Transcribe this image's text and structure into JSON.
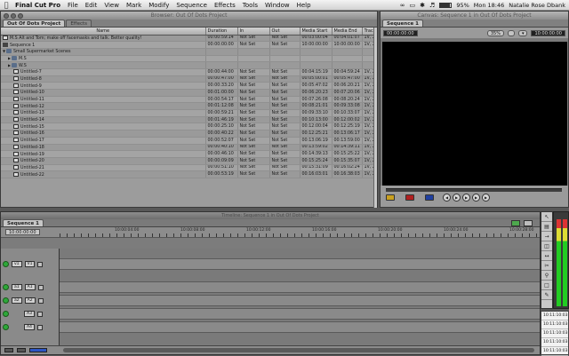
{
  "menubar": {
    "app": "Final Cut Pro",
    "items": [
      "File",
      "Edit",
      "View",
      "Mark",
      "Modify",
      "Sequence",
      "Effects",
      "Tools",
      "Window",
      "Help"
    ],
    "battery": "95%",
    "clock": "Mon 18:46",
    "user": "Natalie Rose Dbank"
  },
  "browser": {
    "title": "Browser: Out Of Dots Project",
    "tabs": [
      "Out Of Dots Project",
      "Effects"
    ],
    "columns": [
      "Name",
      "Duration",
      "In",
      "Out",
      "Media Start",
      "Media End",
      "Tracks"
    ],
    "rows": [
      {
        "kind": "clip",
        "indent": 0,
        "name": "M.S Alt and Tom; make off facemasks and talk. Better quality!",
        "duration": "00:00:59:14",
        "in": "Not Set",
        "out": "Not Set",
        "ms": "00:03:00:04",
        "me": "00:04:01:07",
        "tr": "1V, 2"
      },
      {
        "kind": "seq",
        "indent": 0,
        "name": "Sequence 1",
        "duration": "00:00:00:00",
        "in": "Not Set",
        "out": "Not Set",
        "ms": "10:00:00:00",
        "me": "10:00:00:00",
        "tr": "1V, 2"
      },
      {
        "kind": "bin",
        "indent": 0,
        "name": "Small Supermarket Scenes",
        "duration": "",
        "in": "",
        "out": "",
        "ms": "",
        "me": "",
        "tr": ""
      },
      {
        "kind": "bin",
        "indent": 1,
        "name": "M.S",
        "duration": "",
        "in": "",
        "out": "",
        "ms": "",
        "me": "",
        "tr": ""
      },
      {
        "kind": "bin",
        "indent": 1,
        "name": "W.S",
        "duration": "",
        "in": "",
        "out": "",
        "ms": "",
        "me": "",
        "tr": ""
      },
      {
        "kind": "clip",
        "indent": 2,
        "name": "Untitled-7",
        "duration": "00:00:44:00",
        "in": "Not Set",
        "out": "Not Set",
        "ms": "00:04:15:19",
        "me": "00:04:59:24",
        "tr": "1V, 2"
      },
      {
        "kind": "clip",
        "indent": 2,
        "name": "Untitled-8",
        "duration": "00:00:47:00",
        "in": "Not Set",
        "out": "Not Set",
        "ms": "00:05:00:01",
        "me": "00:05:47:00",
        "tr": "1V, 2"
      },
      {
        "kind": "clip",
        "indent": 2,
        "name": "Untitled-9",
        "duration": "00:00:33:20",
        "in": "Not Set",
        "out": "Not Set",
        "ms": "00:05:47:02",
        "me": "00:06:20:21",
        "tr": "1V, 2"
      },
      {
        "kind": "clip",
        "indent": 2,
        "name": "Untitled-10",
        "duration": "00:01:00:00",
        "in": "Not Set",
        "out": "Not Set",
        "ms": "00:06:20:23",
        "me": "00:07:20:06",
        "tr": "1V, 2"
      },
      {
        "kind": "clip",
        "indent": 2,
        "name": "Untitled-11",
        "duration": "00:00:54:17",
        "in": "Not Set",
        "out": "Not Set",
        "ms": "00:07:26:08",
        "me": "00:08:20:24",
        "tr": "1V, 2"
      },
      {
        "kind": "clip",
        "indent": 2,
        "name": "Untitled-12",
        "duration": "00:01:12:08",
        "in": "Not Set",
        "out": "Not Set",
        "ms": "00:08:21:01",
        "me": "00:09:33:08",
        "tr": "1V, 2"
      },
      {
        "kind": "clip",
        "indent": 2,
        "name": "Untitled-13",
        "duration": "00:00:59:21",
        "in": "Not Set",
        "out": "Not Set",
        "ms": "00:09:33:10",
        "me": "00:10:33:07",
        "tr": "1V, 2"
      },
      {
        "kind": "clip",
        "indent": 2,
        "name": "Untitled-14",
        "duration": "00:01:46:19",
        "in": "Not Set",
        "out": "Not Set",
        "ms": "00:10:13:00",
        "me": "00:12:00:02",
        "tr": "1V, 2"
      },
      {
        "kind": "clip",
        "indent": 2,
        "name": "Untitled-15",
        "duration": "00:00:25:10",
        "in": "Not Set",
        "out": "Not Set",
        "ms": "00:12:00:04",
        "me": "00:12:25:19",
        "tr": "1V, 2"
      },
      {
        "kind": "clip",
        "indent": 2,
        "name": "Untitled-16",
        "duration": "00:00:40:22",
        "in": "Not Set",
        "out": "Not Set",
        "ms": "00:12:25:21",
        "me": "00:13:06:17",
        "tr": "1V, 2"
      },
      {
        "kind": "clip",
        "indent": 2,
        "name": "Untitled-17",
        "duration": "00:00:52:07",
        "in": "Not Set",
        "out": "Not Set",
        "ms": "00:13:06:19",
        "me": "00:13:59:00",
        "tr": "1V, 2"
      },
      {
        "kind": "clip",
        "indent": 2,
        "name": "Untitled-18",
        "duration": "00:00:40:10",
        "in": "Not Set",
        "out": "Not Set",
        "ms": "00:13:59:02",
        "me": "00:14:39:11",
        "tr": "1V, 2"
      },
      {
        "kind": "clip",
        "indent": 2,
        "name": "Untitled-19",
        "duration": "00:00:46:10",
        "in": "Not Set",
        "out": "Not Set",
        "ms": "00:14:39:13",
        "me": "00:15:25:22",
        "tr": "1V, 2"
      },
      {
        "kind": "clip",
        "indent": 2,
        "name": "Untitled-20",
        "duration": "00:00:09:09",
        "in": "Not Set",
        "out": "Not Set",
        "ms": "00:15:25:24",
        "me": "00:15:35:07",
        "tr": "1V, 2"
      },
      {
        "kind": "clip",
        "indent": 2,
        "name": "Untitled-21",
        "duration": "00:00:51:10",
        "in": "Not Set",
        "out": "Not Set",
        "ms": "00:15:31:09",
        "me": "00:16:02:24",
        "tr": "1V, 2"
      },
      {
        "kind": "clip",
        "indent": 2,
        "name": "Untitled-22",
        "duration": "00:00:53:19",
        "in": "Not Set",
        "out": "Not Set",
        "ms": "00:16:03:01",
        "me": "00:16:38:03",
        "tr": "1V, 2"
      }
    ]
  },
  "canvas": {
    "title": "Canvas: Sequence 1 in Out Of Dots Project",
    "tab": "Sequence 1",
    "timecode_left": "00:00:00:00",
    "zoom": "35%",
    "view": "",
    "timecode_right": "10:00:00:00"
  },
  "timeline": {
    "title": "Timeline: Sequence 1 in Out Of Dots Project",
    "tab": "Sequence 1",
    "current_tc": "10:00:00:00",
    "ruler": [
      "10:00:04:00",
      "10:00:08:00",
      "10:00:12:00",
      "10:00:16:00",
      "10:00:20:00",
      "10:00:24:00",
      "10:00:28:00"
    ],
    "video_tracks": [
      {
        "src": "v1",
        "dst": "V1"
      }
    ],
    "audio_tracks": [
      {
        "src": "a1",
        "dst": "A1"
      },
      {
        "src": "a2",
        "dst": "A2"
      },
      {
        "src": "",
        "dst": "A3"
      },
      {
        "src": "",
        "dst": "A4"
      }
    ]
  },
  "tc_list": [
    "10:11:10:03",
    "10:11:10:03",
    "10:11:10:03",
    "10:11:10:03",
    "10:11:10:03"
  ],
  "colors": {
    "track_active": "#2ea83a",
    "canvas_bg": "#000000"
  }
}
